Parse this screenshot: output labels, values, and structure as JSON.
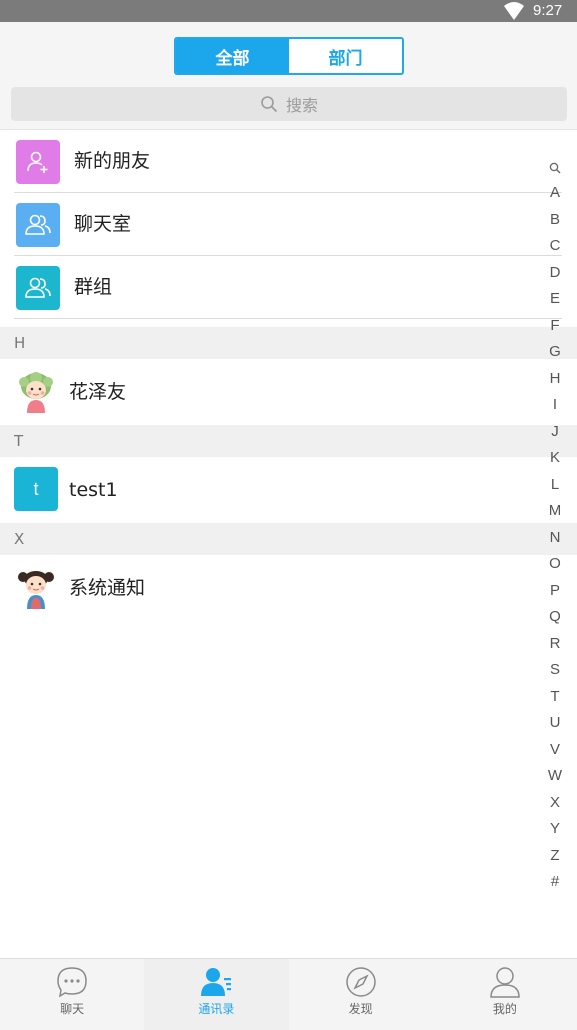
{
  "status_bar": {
    "time": "9:27"
  },
  "segmented": {
    "all_label": "全部",
    "dept_label": "部门"
  },
  "search": {
    "placeholder": "搜索"
  },
  "fixed_entries": [
    {
      "label": "新的朋友",
      "icon": "add-friend-icon",
      "color": "#e07ce8"
    },
    {
      "label": "聊天室",
      "icon": "chatroom-icon",
      "color": "#5aaef2"
    },
    {
      "label": "群组",
      "icon": "group-icon",
      "color": "#1cb6cf"
    }
  ],
  "sections": [
    {
      "letter": "H",
      "contacts": [
        {
          "name": "花泽友",
          "avatar": "cartoon-avatar"
        }
      ]
    },
    {
      "letter": "T",
      "contacts": [
        {
          "name": "test1",
          "avatar_letter": "t"
        }
      ]
    },
    {
      "letter": "X",
      "contacts": [
        {
          "name": "系统通知",
          "avatar": "cartoon-avatar"
        }
      ]
    }
  ],
  "side_index": [
    "A",
    "B",
    "C",
    "D",
    "E",
    "F",
    "G",
    "H",
    "I",
    "J",
    "K",
    "L",
    "M",
    "N",
    "O",
    "P",
    "Q",
    "R",
    "S",
    "T",
    "U",
    "V",
    "W",
    "X",
    "Y",
    "Z",
    "#"
  ],
  "bottom_nav": [
    {
      "label": "聊天",
      "icon": "chat-bubble-icon",
      "active": false
    },
    {
      "label": "通讯录",
      "icon": "contacts-icon",
      "active": true
    },
    {
      "label": "发现",
      "icon": "compass-icon",
      "active": false
    },
    {
      "label": "我的",
      "icon": "profile-icon",
      "active": false
    }
  ],
  "colors": {
    "accent": "#1ca6ec",
    "status_bar": "#7b7b7b"
  }
}
